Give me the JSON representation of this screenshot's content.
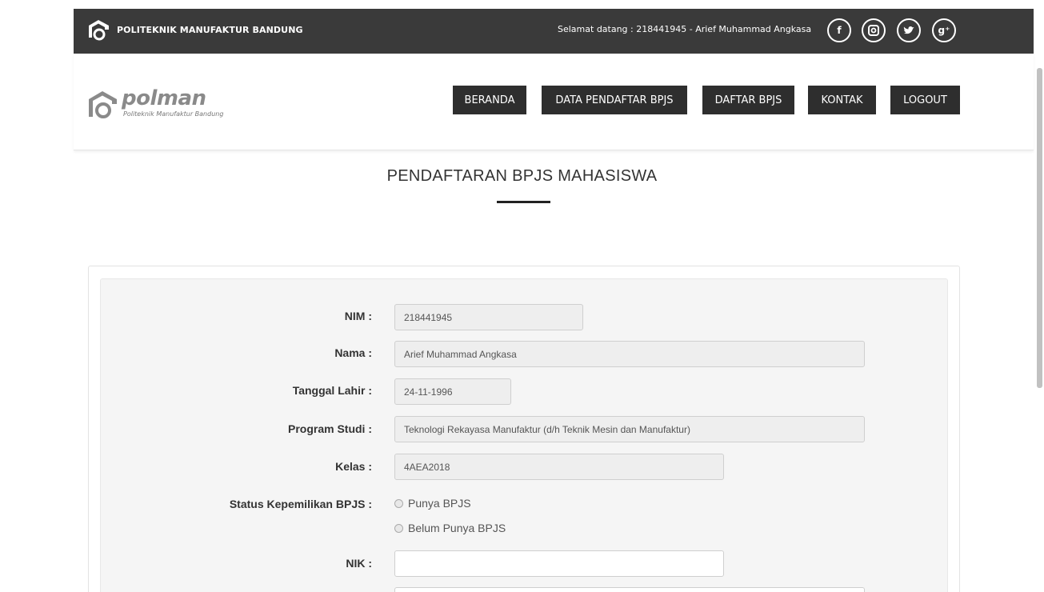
{
  "topbar": {
    "brand": "POLITEKNIK MANUFAKTUR BANDUNG",
    "welcome": "Selamat datang : 218441945 - Arief Muhammad Angkasa",
    "social": [
      {
        "name": "facebook",
        "glyph": "f"
      },
      {
        "name": "instagram",
        "glyph": "◘"
      },
      {
        "name": "twitter",
        "glyph": "✔"
      },
      {
        "name": "google-plus",
        "glyph": "g⁺"
      }
    ]
  },
  "logo": {
    "word": "polman",
    "subtitle": "Politeknik Manufaktur Bandung"
  },
  "nav": {
    "items": [
      "BERANDA",
      "DATA PENDAFTAR BPJS",
      "DAFTAR BPJS",
      "KONTAK",
      "LOGOUT"
    ]
  },
  "page": {
    "title": "PENDAFTARAN BPJS MAHASISWA"
  },
  "form": {
    "nim_label": "NIM :",
    "nim_value": "218441945",
    "nama_label": "Nama :",
    "nama_value": "Arief Muhammad Angkasa",
    "tgl_label": "Tanggal Lahir :",
    "tgl_value": "24-11-1996",
    "prodi_label": "Program Studi :",
    "prodi_value": "Teknologi Rekayasa Manufaktur (d/h Teknik Mesin dan Manufaktur)",
    "kelas_label": "Kelas :",
    "kelas_value": "4AEA2018",
    "status_label": "Status Kepemilikan BPJS :",
    "status_options": [
      "Punya BPJS",
      "Belum Punya BPJS"
    ],
    "nik_label": "NIK :",
    "nik_value": ""
  },
  "colors": {
    "topbar": "#3a3a3a",
    "nav_button": "#2e2e2e",
    "panel_bg": "#f5f5f5"
  }
}
